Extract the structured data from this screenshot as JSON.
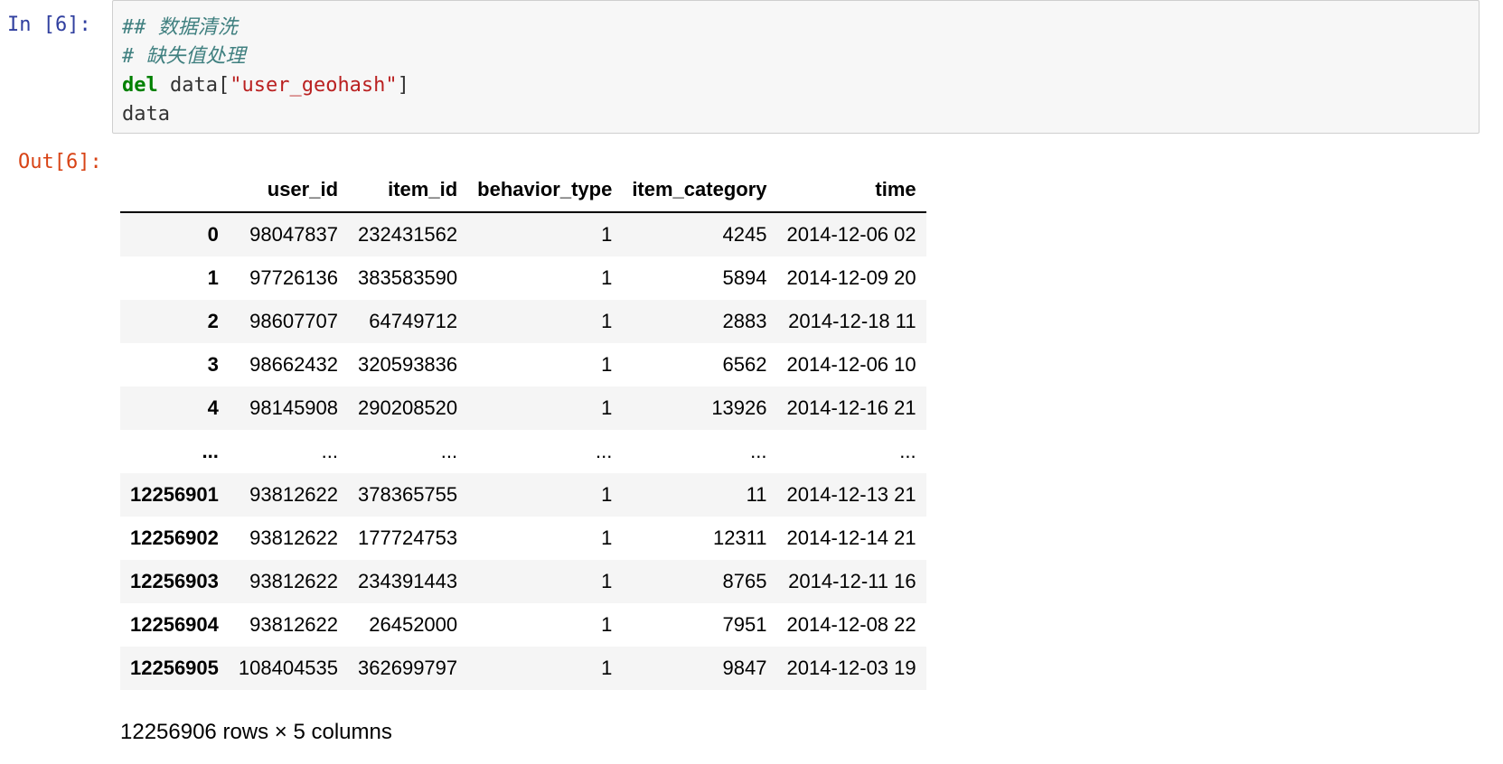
{
  "input_cell": {
    "prompt": "In  [6]:",
    "lines": {
      "l1": "## 数据清洗",
      "l2": "# 缺失值处理",
      "l3_kw": "del",
      "l3_pre": " data[",
      "l3_str": "\"user_geohash\"",
      "l3_post": "]",
      "l4": "data"
    }
  },
  "output_cell": {
    "prompt": "Out[6]:",
    "columns": [
      "",
      "user_id",
      "item_id",
      "behavior_type",
      "item_category",
      "time"
    ],
    "rows": [
      [
        "0",
        "98047837",
        "232431562",
        "1",
        "4245",
        "2014-12-06 02"
      ],
      [
        "1",
        "97726136",
        "383583590",
        "1",
        "5894",
        "2014-12-09 20"
      ],
      [
        "2",
        "98607707",
        "64749712",
        "1",
        "2883",
        "2014-12-18 11"
      ],
      [
        "3",
        "98662432",
        "320593836",
        "1",
        "6562",
        "2014-12-06 10"
      ],
      [
        "4",
        "98145908",
        "290208520",
        "1",
        "13926",
        "2014-12-16 21"
      ],
      [
        "...",
        "...",
        "...",
        "...",
        "...",
        "..."
      ],
      [
        "12256901",
        "93812622",
        "378365755",
        "1",
        "11",
        "2014-12-13 21"
      ],
      [
        "12256902",
        "93812622",
        "177724753",
        "1",
        "12311",
        "2014-12-14 21"
      ],
      [
        "12256903",
        "93812622",
        "234391443",
        "1",
        "8765",
        "2014-12-11 16"
      ],
      [
        "12256904",
        "93812622",
        "26452000",
        "1",
        "7951",
        "2014-12-08 22"
      ],
      [
        "12256905",
        "108404535",
        "362699797",
        "1",
        "9847",
        "2014-12-03 19"
      ]
    ],
    "shape_text": "12256906 rows × 5 columns"
  }
}
